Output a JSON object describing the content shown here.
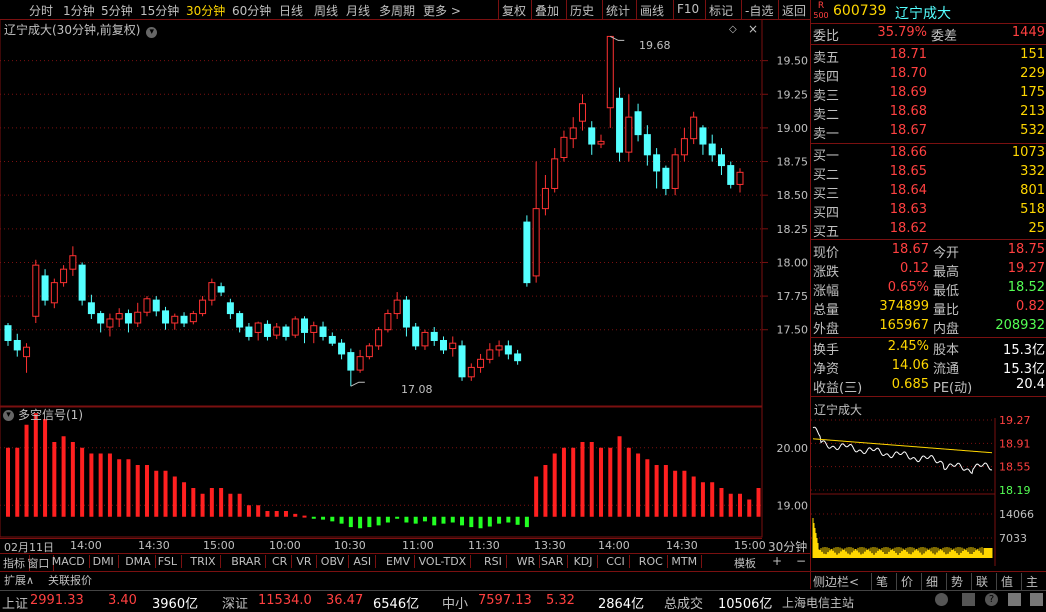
{
  "toolbar": {
    "periods": [
      "分时",
      "1分钟",
      "5分钟",
      "15分钟",
      "30分钟",
      "60分钟",
      "日线",
      "周线",
      "月线",
      "多周期",
      "更多 >"
    ],
    "active_period": "30分钟",
    "actions": [
      "复权",
      "叠加",
      "历史",
      "统计",
      "画线",
      "F10",
      "标记",
      "-自选",
      "返回"
    ]
  },
  "chart_title": "辽宁成大(30分钟,前复权)",
  "indicator_title": "多空信号(1)",
  "price_axis": [
    "19.50",
    "19.25",
    "19.00",
    "18.75",
    "18.50",
    "18.25",
    "18.00",
    "17.75",
    "17.50"
  ],
  "indicator_axis": [
    "20.00",
    "19.00"
  ],
  "annotations": {
    "high": "19.68",
    "low": "17.08"
  },
  "time_axis": [
    "02月11日",
    "14:00",
    "14:30",
    "15:00",
    "10:00",
    "10:30",
    "11:00",
    "11:30",
    "13:30",
    "14:00",
    "14:30",
    "15:00"
  ],
  "period_label": "30分钟",
  "indicator_tabs": [
    "指标",
    "窗口",
    "MACD",
    "DMI",
    "DMA",
    "FSL",
    "TRIX",
    "BRAR",
    "CR",
    "VR",
    "OBV",
    "ASI",
    "EMV",
    "VOL-TDX",
    "RSI",
    "WR",
    "SAR",
    "KDJ",
    "CCI",
    "ROC",
    "MTM"
  ],
  "template_label": "模板",
  "bottom_tabs": [
    "扩展∧",
    "关联报价"
  ],
  "side_tabs": [
    "侧边栏<",
    "笔",
    "价",
    "细",
    "势",
    "联",
    "值",
    "主",
    "筹"
  ],
  "stock": {
    "code": "600739",
    "name": "辽宁成大",
    "badge": "R",
    "badge2": "500"
  },
  "order_ratio": {
    "label": "委比",
    "value": "35.79%",
    "diff_label": "委差",
    "diff": "1449"
  },
  "asks": [
    {
      "label": "卖五",
      "price": "18.71",
      "vol": "151"
    },
    {
      "label": "卖四",
      "price": "18.70",
      "vol": "229"
    },
    {
      "label": "卖三",
      "price": "18.69",
      "vol": "175"
    },
    {
      "label": "卖二",
      "price": "18.68",
      "vol": "213"
    },
    {
      "label": "卖一",
      "price": "18.67",
      "vol": "532"
    }
  ],
  "bids": [
    {
      "label": "买一",
      "price": "18.66",
      "vol": "1073"
    },
    {
      "label": "买二",
      "price": "18.65",
      "vol": "332"
    },
    {
      "label": "买三",
      "price": "18.64",
      "vol": "801"
    },
    {
      "label": "买四",
      "price": "18.63",
      "vol": "518"
    },
    {
      "label": "买五",
      "price": "18.62",
      "vol": "25"
    }
  ],
  "stats": [
    {
      "l1": "现价",
      "v1": "18.67",
      "l2": "今开",
      "v2": "18.75"
    },
    {
      "l1": "涨跌",
      "v1": "0.12",
      "l2": "最高",
      "v2": "19.27"
    },
    {
      "l1": "涨幅",
      "v1": "0.65%",
      "l2": "最低",
      "v2": "18.52"
    },
    {
      "l1": "总量",
      "v1": "374899",
      "l2": "量比",
      "v2": "0.82"
    },
    {
      "l1": "外盘",
      "v1": "165967",
      "l2": "内盘",
      "v2": "208932"
    }
  ],
  "stats2": [
    {
      "l1": "换手",
      "v1": "2.45%",
      "l2": "股本",
      "v2": "15.3亿"
    },
    {
      "l1": "净资",
      "v1": "14.06",
      "l2": "流通",
      "v2": "15.3亿"
    },
    {
      "l1": "收益(三)",
      "v1": "0.685",
      "l2": "PE(动)",
      "v2": "20.4"
    }
  ],
  "mini_chart": {
    "title": "辽宁成大",
    "price_axis": [
      "19.27",
      "18.91",
      "18.55",
      "18.19"
    ],
    "vol_axis": [
      "14066",
      "7033"
    ]
  },
  "status_bar": {
    "items": [
      {
        "name": "上证",
        "value": "2991.33",
        "change": "3.40",
        "amount": "3960亿"
      },
      {
        "name": "深证",
        "value": "11534.0",
        "change": "36.47",
        "amount": "6546亿"
      },
      {
        "name": "中小",
        "value": "7597.13",
        "change": "5.32",
        "amount": "2864亿"
      }
    ],
    "total_label": "总成交",
    "total": "10506亿",
    "source": "上海电信主站"
  },
  "colors": {
    "up": "#ff3232",
    "down": "#54ffff",
    "bg": "#000000",
    "grid": "#7a1010",
    "text": "#c0c0c0",
    "accent": "#ffd700",
    "signal_up": "#ff2020",
    "signal_down": "#22ff22"
  },
  "chart_data": [
    {
      "type": "candlestick",
      "title": "辽宁成大(30分钟,前复权)",
      "ylim": [
        17.0,
        19.75
      ],
      "annotations": [
        {
          "label": "19.68",
          "value": 19.68
        },
        {
          "label": "17.08",
          "value": 17.08
        }
      ],
      "candles": [
        [
          17.53,
          17.42,
          17.55,
          17.38
        ],
        [
          17.42,
          17.35,
          17.47,
          17.3
        ],
        [
          17.3,
          17.37,
          17.4,
          17.18
        ],
        [
          17.6,
          17.98,
          18.02,
          17.55
        ],
        [
          17.9,
          17.72,
          17.95,
          17.68
        ],
        [
          17.7,
          17.85,
          17.88,
          17.66
        ],
        [
          17.85,
          17.95,
          17.98,
          17.82
        ],
        [
          17.95,
          18.05,
          18.12,
          17.9
        ],
        [
          17.98,
          17.72,
          18.0,
          17.68
        ],
        [
          17.7,
          17.62,
          17.76,
          17.58
        ],
        [
          17.62,
          17.55,
          17.64,
          17.48
        ],
        [
          17.52,
          17.58,
          17.62,
          17.45
        ],
        [
          17.58,
          17.62,
          17.66,
          17.52
        ],
        [
          17.62,
          17.55,
          17.65,
          17.48
        ],
        [
          17.55,
          17.63,
          17.7,
          17.52
        ],
        [
          17.63,
          17.73,
          17.75,
          17.6
        ],
        [
          17.72,
          17.64,
          17.75,
          17.6
        ],
        [
          17.64,
          17.55,
          17.67,
          17.5
        ],
        [
          17.55,
          17.6,
          17.62,
          17.5
        ],
        [
          17.6,
          17.55,
          17.63,
          17.52
        ],
        [
          17.56,
          17.62,
          17.64,
          17.54
        ],
        [
          17.62,
          17.72,
          17.75,
          17.6
        ],
        [
          17.72,
          17.85,
          17.88,
          17.68
        ],
        [
          17.82,
          17.78,
          17.85,
          17.75
        ],
        [
          17.7,
          17.62,
          17.73,
          17.58
        ],
        [
          17.62,
          17.52,
          17.64,
          17.48
        ],
        [
          17.52,
          17.45,
          17.55,
          17.42
        ],
        [
          17.48,
          17.55,
          17.56,
          17.42
        ],
        [
          17.54,
          17.45,
          17.57,
          17.42
        ],
        [
          17.46,
          17.52,
          17.55,
          17.43
        ],
        [
          17.52,
          17.45,
          17.54,
          17.42
        ],
        [
          17.46,
          17.58,
          17.6,
          17.44
        ],
        [
          17.58,
          17.48,
          17.6,
          17.4
        ],
        [
          17.48,
          17.53,
          17.56,
          17.4
        ],
        [
          17.52,
          17.45,
          17.56,
          17.42
        ],
        [
          17.45,
          17.4,
          17.48,
          17.38
        ],
        [
          17.4,
          17.32,
          17.43,
          17.28
        ],
        [
          17.33,
          17.2,
          17.36,
          17.08
        ],
        [
          17.2,
          17.3,
          17.35,
          17.18
        ],
        [
          17.3,
          17.38,
          17.4,
          17.28
        ],
        [
          17.38,
          17.5,
          17.52,
          17.35
        ],
        [
          17.5,
          17.62,
          17.65,
          17.48
        ],
        [
          17.62,
          17.72,
          17.78,
          17.58
        ],
        [
          17.72,
          17.52,
          17.75,
          17.45
        ],
        [
          17.52,
          17.38,
          17.55,
          17.35
        ],
        [
          17.38,
          17.48,
          17.5,
          17.35
        ],
        [
          17.48,
          17.42,
          17.52,
          17.38
        ],
        [
          17.42,
          17.35,
          17.45,
          17.32
        ],
        [
          17.36,
          17.4,
          17.45,
          17.3
        ],
        [
          17.38,
          17.15,
          17.42,
          17.12
        ],
        [
          17.15,
          17.22,
          17.25,
          17.12
        ],
        [
          17.22,
          17.28,
          17.32,
          17.18
        ],
        [
          17.28,
          17.35,
          17.4,
          17.25
        ],
        [
          17.35,
          17.38,
          17.42,
          17.3
        ],
        [
          17.38,
          17.32,
          17.42,
          17.28
        ],
        [
          17.32,
          17.27,
          17.35,
          17.24
        ],
        [
          18.3,
          17.85,
          18.35,
          17.82
        ],
        [
          17.9,
          18.4,
          18.75,
          17.85
        ],
        [
          18.4,
          18.55,
          18.65,
          18.35
        ],
        [
          18.55,
          18.77,
          18.85,
          18.52
        ],
        [
          18.78,
          18.93,
          18.98,
          18.75
        ],
        [
          18.92,
          19.0,
          19.08,
          18.85
        ],
        [
          19.05,
          19.18,
          19.25,
          18.98
        ],
        [
          19.0,
          18.88,
          19.05,
          18.8
        ],
        [
          18.88,
          18.9,
          18.95,
          18.85
        ],
        [
          19.15,
          19.68,
          19.68,
          19.0
        ],
        [
          19.22,
          18.82,
          19.3,
          18.75
        ],
        [
          18.82,
          19.08,
          19.25,
          18.75
        ],
        [
          19.12,
          18.95,
          19.18,
          18.9
        ],
        [
          18.95,
          18.8,
          19.02,
          18.72
        ],
        [
          18.8,
          18.68,
          18.85,
          18.55
        ],
        [
          18.7,
          18.55,
          18.72,
          18.5
        ],
        [
          18.55,
          18.8,
          18.85,
          18.5
        ],
        [
          18.8,
          18.92,
          19.0,
          18.75
        ],
        [
          18.92,
          19.08,
          19.12,
          18.88
        ],
        [
          19.0,
          18.88,
          19.02,
          18.8
        ],
        [
          18.88,
          18.8,
          18.95,
          18.75
        ],
        [
          18.8,
          18.72,
          18.85,
          18.65
        ],
        [
          18.72,
          18.58,
          18.75,
          18.55
        ],
        [
          18.58,
          18.67,
          18.7,
          18.52
        ]
      ]
    },
    {
      "type": "bar",
      "title": "多空信号(1)",
      "ylim": [
        18.5,
        20.5
      ],
      "values": [
        20.0,
        20.0,
        20.4,
        20.6,
        20.5,
        20.1,
        20.2,
        20.1,
        20.0,
        19.9,
        19.9,
        19.9,
        19.8,
        19.8,
        19.7,
        19.7,
        19.6,
        19.6,
        19.5,
        19.4,
        19.3,
        19.2,
        19.3,
        19.3,
        19.2,
        19.2,
        19.0,
        19.0,
        18.9,
        18.9,
        18.9,
        18.85,
        18.82,
        18.78,
        18.75,
        18.72,
        18.68,
        18.62,
        18.6,
        18.62,
        18.65,
        18.7,
        18.78,
        18.7,
        18.68,
        18.72,
        18.65,
        18.68,
        18.7,
        18.65,
        18.62,
        18.6,
        18.63,
        18.68,
        18.7,
        18.66,
        18.62,
        19.5,
        19.7,
        19.9,
        20.0,
        20.0,
        20.1,
        20.1,
        20.0,
        20.0,
        20.2,
        20.0,
        19.9,
        19.8,
        19.7,
        19.7,
        19.6,
        19.6,
        19.5,
        19.4,
        19.4,
        19.3,
        19.2,
        19.2,
        19.1,
        19.3
      ]
    }
  ]
}
